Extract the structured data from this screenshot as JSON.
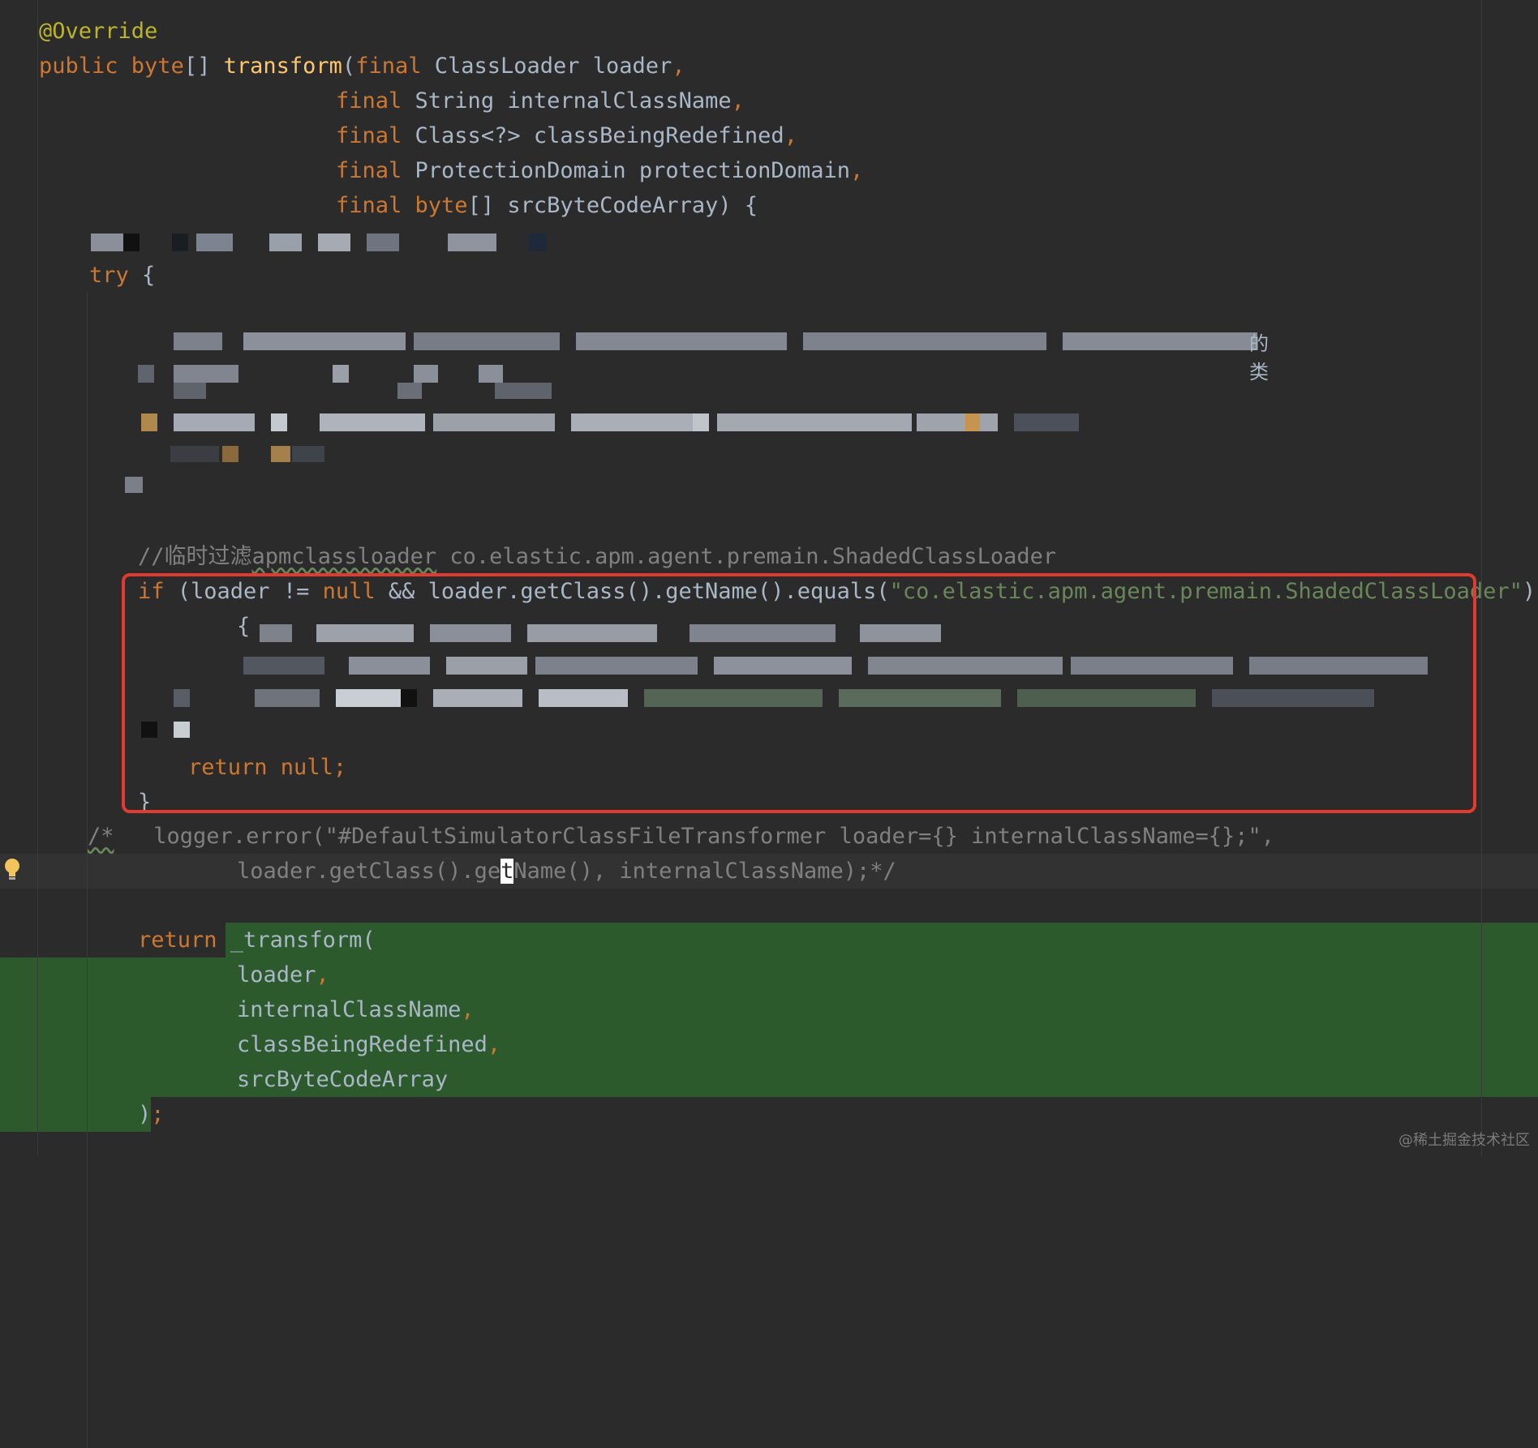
{
  "editor": {
    "lines": {
      "annotation": "@Override",
      "sig_public": "public ",
      "sig_byte": "byte",
      "sig_brackets": "[] ",
      "sig_method": "transform",
      "sig_paren": "(",
      "sig_final1": "final",
      "sig_param1": " ClassLoader loader",
      "comma": ",",
      "param2_final": "final",
      "param2": " String internalClassName",
      "param3_final": "final",
      "param3": " Class<?> classBeingRedefined",
      "param4_final": "final",
      "param4": " ProtectionDomain protectionDomain",
      "param5_final": "final",
      "param5_byte": " byte",
      "param5_rest": "[] srcByteCodeArray) {",
      "try_kw": "try",
      "try_brace": " {",
      "blur_suffix": "的类",
      "comment_prefix": "//临时过滤",
      "comment_word": "apmclassloader",
      "comment_rest": " co.elastic.apm.agent.premain.ShadedClassLoader",
      "if_kw": "if",
      "if_mid1": " (loader != ",
      "null_kw": "null",
      "if_mid2": " && loader.getClass().getName().equals(",
      "if_string": "\"co.elastic.apm.agent.premain.ShadedClassLoader\"",
      "if_end": ")",
      "open_brace": "{",
      "return_kw": "return",
      "return_null_kw": " null",
      "semicolon": ";",
      "close_brace": "}",
      "log_comment_start": "/*",
      "log_line1": "   logger.error(\"#DefaultSimulatorClassFileTransformer loader={} internalClassName={};\",",
      "log_line2_a": "loader.getClass().ge",
      "log_line2_caret": "t",
      "log_line2_b": "Name(), internalClassName);*/",
      "ret_kw": "return",
      "ret_call": " _transform(",
      "arg1": "loader",
      "arg2": "internalClassName",
      "arg3": "classBeingRedefined",
      "arg4": "srcByteCodeArray",
      "close_call": ")",
      "close_semicolon": ";"
    },
    "gutter_icon": "lightbulb-icon",
    "highlight_color": "#e03a31",
    "added_block_color": "#2c5a2c"
  },
  "watermark": "@稀土掘金技术社区"
}
